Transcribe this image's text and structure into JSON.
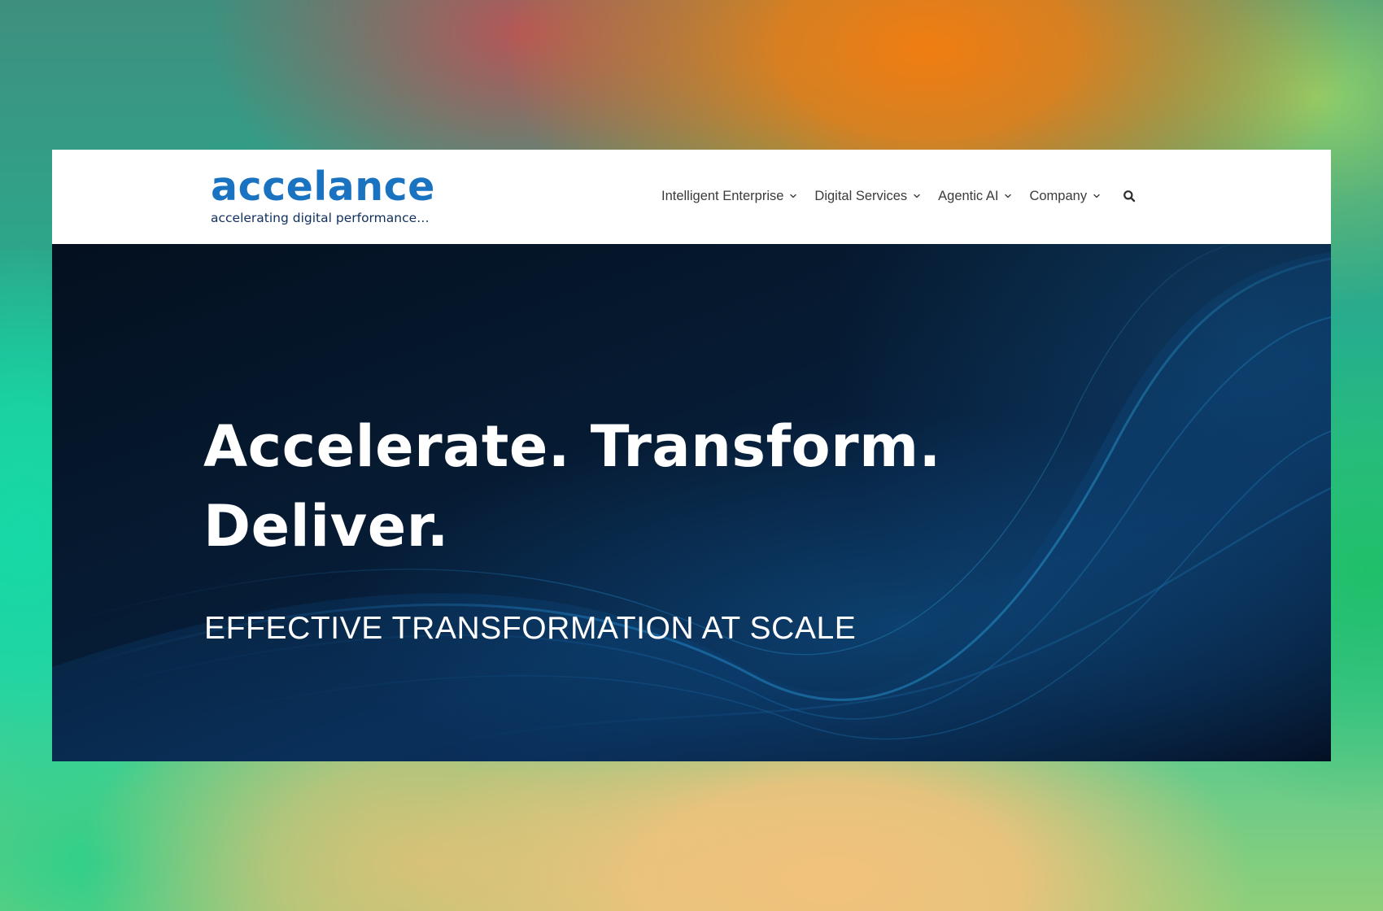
{
  "header": {
    "logo": {
      "wordmark": "accelance",
      "tagline": "accelerating digital performance…"
    },
    "nav": {
      "items": [
        {
          "label": "Intelligent Enterprise",
          "icon": "chevron-down-icon"
        },
        {
          "label": "Digital Services",
          "icon": "chevron-down-icon"
        },
        {
          "label": "Agentic AI",
          "icon": "chevron-down-icon"
        },
        {
          "label": "Company",
          "icon": "chevron-down-icon"
        }
      ],
      "search_icon": "search-icon"
    }
  },
  "hero": {
    "title_line1": "Accelerate. Transform.",
    "title_line2": "Deliver.",
    "subtitle": "EFFECTIVE TRANSFORMATION AT SCALE"
  },
  "colors": {
    "brand_blue": "#1a73c1",
    "tagline_navy": "#0f2f5c",
    "hero_background": "#061b33",
    "nav_text": "#3b3b3b"
  }
}
